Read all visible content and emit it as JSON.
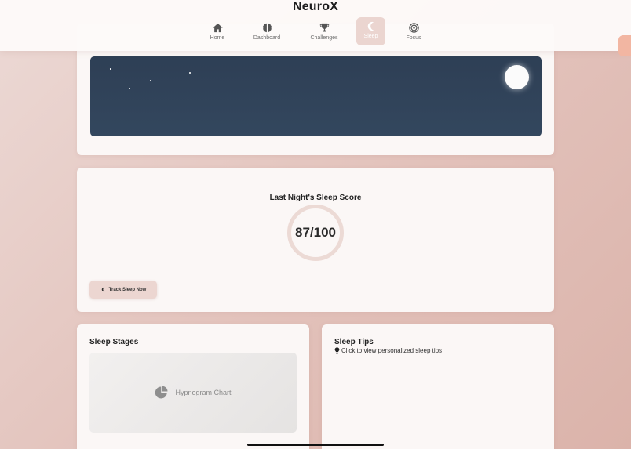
{
  "app": {
    "brand": "NeuroX"
  },
  "nav": {
    "items": [
      {
        "label": "Home",
        "icon": "home-icon"
      },
      {
        "label": "Dashboard",
        "icon": "brain-icon"
      },
      {
        "label": "Challenges",
        "icon": "trophy-icon"
      },
      {
        "label": "Sleep",
        "icon": "moon-icon",
        "active": true
      },
      {
        "label": "Focus",
        "icon": "target-icon"
      }
    ]
  },
  "score": {
    "title": "Last Night's Sleep Score",
    "value": "87/100",
    "track_button": "Track Sleep Now"
  },
  "stages": {
    "title": "Sleep Stages",
    "chart_label": "Hypnogram Chart"
  },
  "tips": {
    "title": "Sleep Tips",
    "text": "Click to view personalized sleep tips"
  },
  "colors": {
    "night_sky": "#2e3f55",
    "accent": "#ebd5d0",
    "side_tab": "#f2b6a2"
  }
}
